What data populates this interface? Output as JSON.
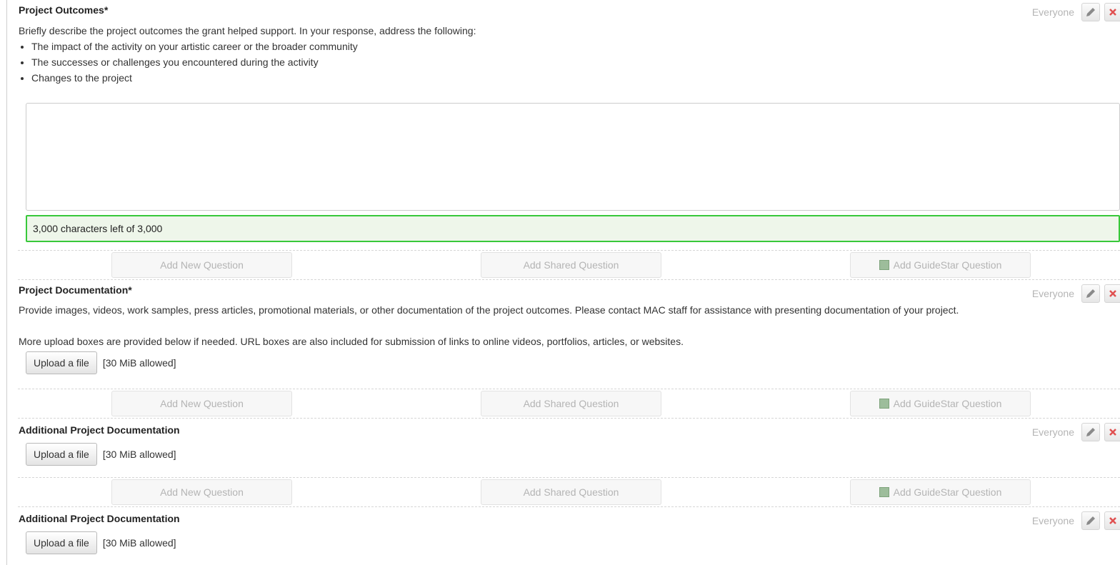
{
  "questions": [
    {
      "title": "Project Outcomes*",
      "visibility": "Everyone",
      "description": "Briefly describe the project outcomes the grant helped support. In your response, address the following:",
      "bullets": [
        "The impact of the activity on your artistic career or the broader community",
        "The successes or challenges you encountered during the activity",
        "Changes to the project"
      ],
      "answer_value": "",
      "counter": "3,000 characters left of 3,000"
    },
    {
      "title": "Project Documentation*",
      "visibility": "Everyone",
      "description": "Provide images, videos, work samples, press articles, promotional materials, or other documentation of the project outcomes. Please contact MAC staff for assistance with presenting documentation of your project.",
      "description2": "More upload boxes are provided below if needed. URL boxes are also included for submission of links to online videos, portfolios, articles, or websites.",
      "upload_label": "Upload a file",
      "upload_limit": "[30 MiB allowed]"
    },
    {
      "title": "Additional Project Documentation",
      "visibility": "Everyone",
      "upload_label": "Upload a file",
      "upload_limit": "[30 MiB allowed]"
    },
    {
      "title": "Additional Project Documentation",
      "visibility": "Everyone",
      "upload_label": "Upload a file",
      "upload_limit": "[30 MiB allowed]"
    }
  ],
  "add_bar": {
    "new_label": "Add New Question",
    "shared_label": "Add Shared Question",
    "guidestar_label": "Add GuideStar Question"
  },
  "icons": {
    "edit": "pencil-icon",
    "delete": "close-icon",
    "guidestar": "guidestar-icon"
  },
  "colors": {
    "counter_border": "#38c83a",
    "counter_bg": "#eef6ea",
    "delete": "#e05050"
  }
}
